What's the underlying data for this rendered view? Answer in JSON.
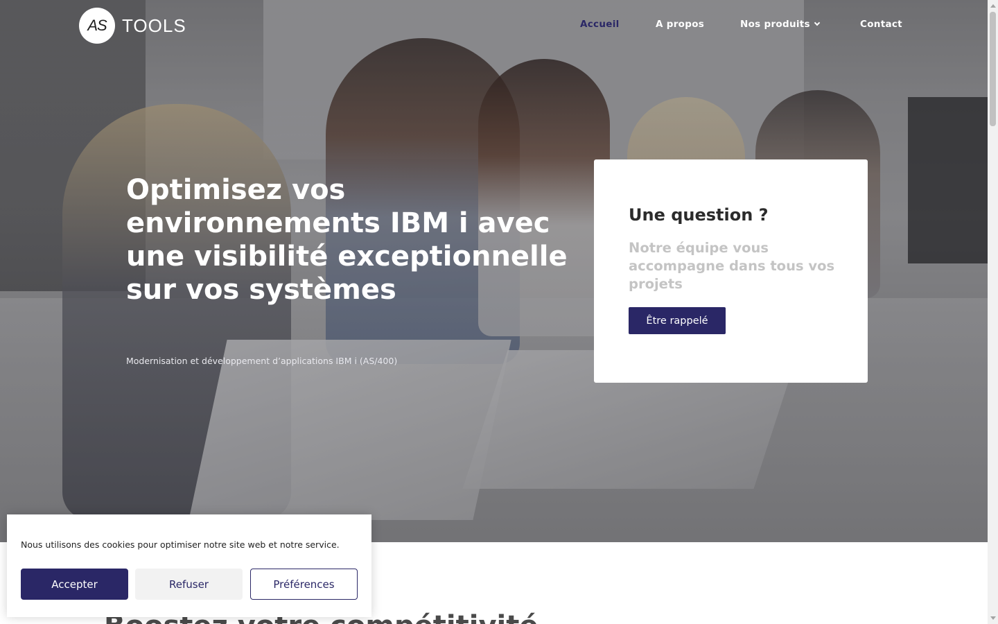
{
  "header": {
    "logo_mark": "AS",
    "logo_word": "TOOLS",
    "nav": [
      {
        "label": "Accueil",
        "active": true
      },
      {
        "label": "A propos",
        "active": false
      },
      {
        "label": "Nos produits",
        "active": false,
        "has_dropdown": true
      },
      {
        "label": "Contact",
        "active": false
      }
    ]
  },
  "hero": {
    "title": "Optimisez vos environnements IBM i avec une visibilité exceptionnelle sur vos systèmes",
    "subtitle": "Modernisation et développement d’applications IBM i (AS/400)"
  },
  "question_card": {
    "title": "Une question ?",
    "text": "Notre équipe vous accompagne dans tous vos projets",
    "button": "Être rappelé"
  },
  "below": {
    "heading": "Boostez votre compétitivité"
  },
  "cookie_banner": {
    "text": "Nous utilisons des cookies pour optimiser notre site web et notre service.",
    "accept": "Accepter",
    "refuse": "Refuser",
    "preferences": "Préférences"
  },
  "colors": {
    "brand": "#2a2766",
    "card_text": "#c4c4c4",
    "white": "#ffffff"
  }
}
